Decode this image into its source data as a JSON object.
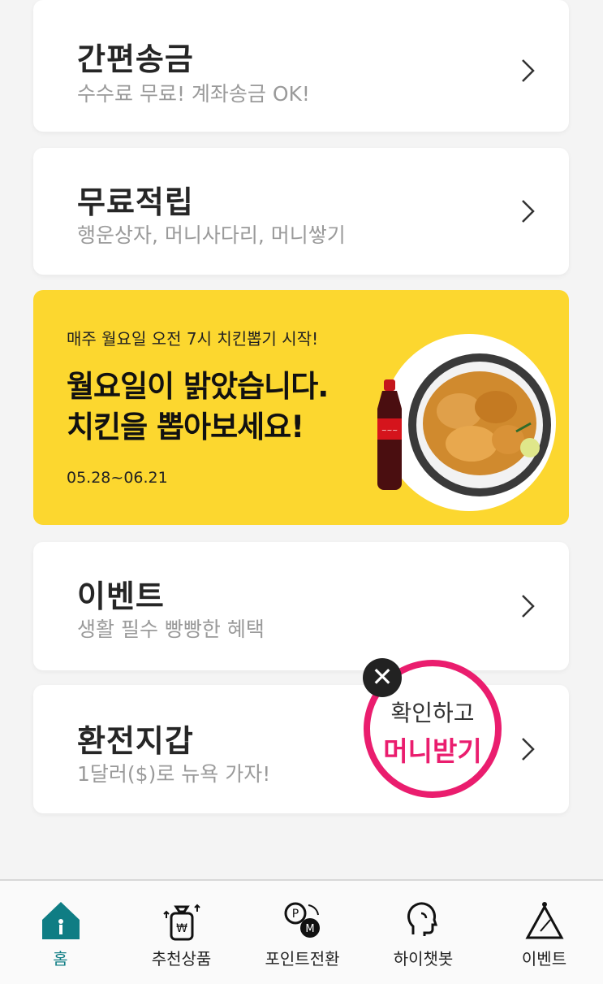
{
  "cards": [
    {
      "title": "간편송금",
      "subtitle": "수수료 무료! 계좌송금 OK!"
    },
    {
      "title": "무료적립",
      "subtitle": "행운상자, 머니사다리, 머니쌓기"
    },
    {
      "title": "이벤트",
      "subtitle": "생활 필수 빵빵한 혜택"
    },
    {
      "title": "환전지갑",
      "subtitle": "1달러($)로 뉴욕 가자!"
    }
  ],
  "banner": {
    "kicker": "매주 월요일 오전 7시 치킨뽑기 시작!",
    "line1": "월요일이 밝았습니다.",
    "line2": "치킨을 뽑아보세요!",
    "dates": "05.28~06.21",
    "bg_color": "#fcd72f"
  },
  "badge": {
    "line1": "확인하고",
    "line2": "머니받기",
    "accent": "#ea1d6e"
  },
  "tabs": [
    {
      "label": "홈",
      "icon": "home-icon",
      "active": true
    },
    {
      "label": "추천상품",
      "icon": "money-bag-icon",
      "active": false
    },
    {
      "label": "포인트전환",
      "icon": "point-exchange-icon",
      "active": false
    },
    {
      "label": "하이챗봇",
      "icon": "chatbot-head-icon",
      "active": false
    },
    {
      "label": "이벤트",
      "icon": "event-triangle-icon",
      "active": false
    }
  ],
  "accent_color": "#0f7d84"
}
